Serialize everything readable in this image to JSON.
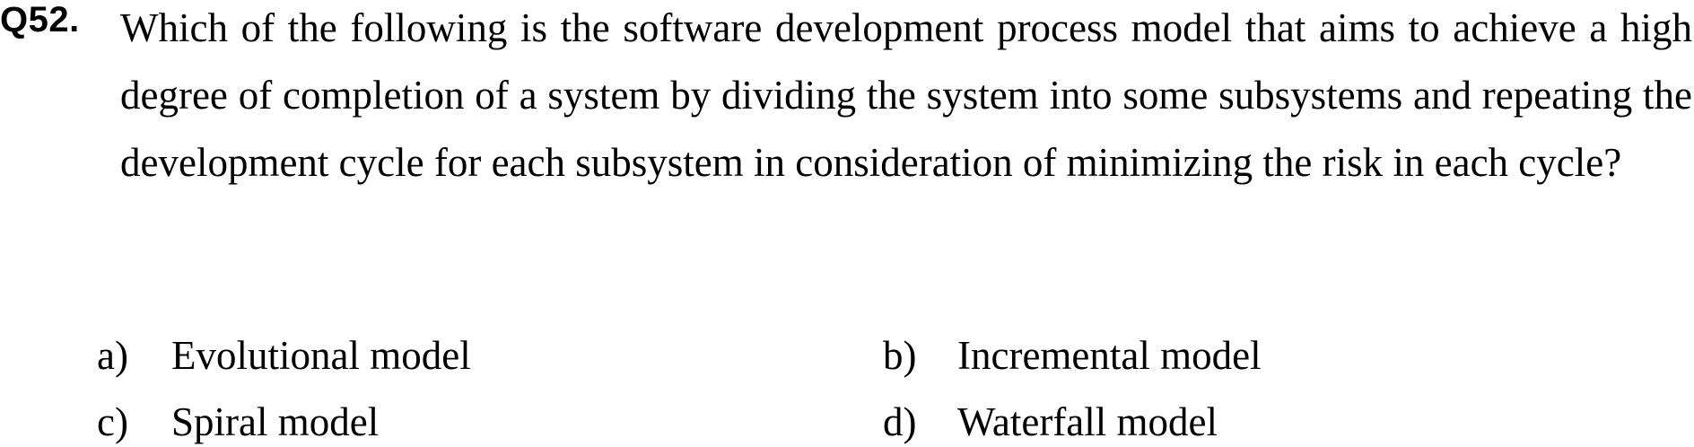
{
  "question": {
    "number": "Q52.",
    "text": "Which of the following is the software development process model that aims to achieve a high degree of completion of a system by dividing the system into some subsystems and repeating the development cycle for each subsystem in consideration of minimizing the risk in each cycle?"
  },
  "choices": [
    {
      "letter": "a)",
      "text": "Evolutional model"
    },
    {
      "letter": "b)",
      "text": "Incremental model"
    },
    {
      "letter": "c)",
      "text": "Spiral model"
    },
    {
      "letter": "d)",
      "text": "Waterfall model"
    }
  ]
}
